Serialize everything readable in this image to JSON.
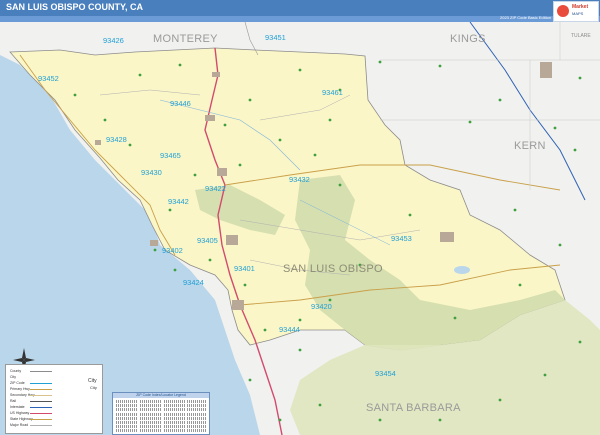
{
  "header": {
    "title": "SAN LUIS OBISPO COUNTY, CA",
    "edition": "2023 ZIP Code Basic Edition",
    "logo_line1": "Market",
    "logo_line2": "MAPS"
  },
  "map": {
    "main_county": "SAN LUIS OBISPO",
    "neighbor_counties": [
      "MONTEREY",
      "KINGS",
      "KERN",
      "SANTA BARBARA",
      "TULARE"
    ],
    "zip_codes": [
      "93426",
      "93451",
      "93452",
      "93446",
      "93461",
      "93428",
      "93465",
      "93430",
      "93422",
      "93432",
      "93442",
      "93402",
      "93405",
      "93453",
      "93401",
      "93424",
      "93420",
      "93444",
      "93454"
    ],
    "colors": {
      "county_fill": "#fbf6c7",
      "forest_fill": "#d6dfb0",
      "water": "#b9d6ea",
      "neighbor": "#f1f1ef",
      "zip_label": "#21a0d6",
      "header": "#4a7fbe"
    }
  },
  "legend": {
    "rows": [
      "County",
      "City",
      "ZIP Code",
      "Primary Hwy",
      "Secondary Hwy",
      "Rail",
      "Interstate",
      "US Highway",
      "State Highway",
      "Major Road",
      "Water"
    ],
    "city_labels": [
      "City",
      "City"
    ]
  },
  "index": {
    "title": "ZIP Code Index/Locator Legend"
  }
}
